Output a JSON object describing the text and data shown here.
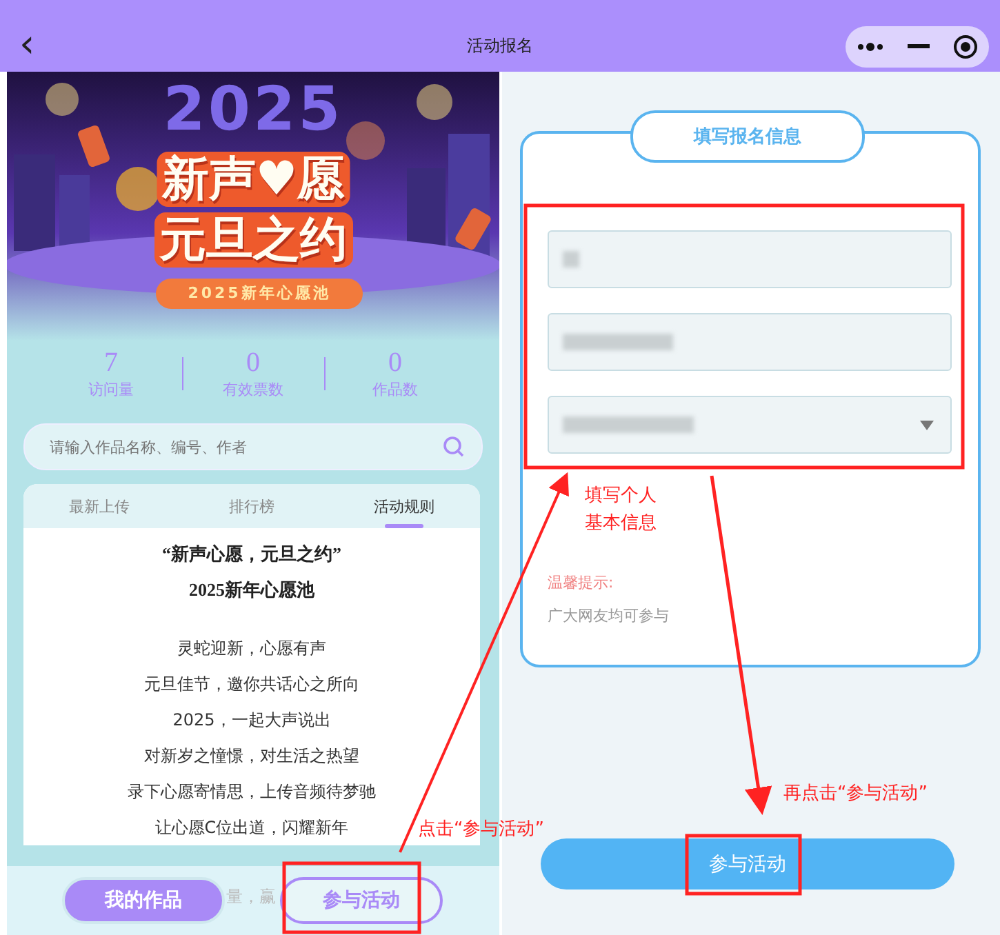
{
  "header": {
    "back": "‹",
    "title": "活动报名"
  },
  "banner": {
    "kind": "picture",
    "year": "2025",
    "title_lines": [
      "新声♥愿",
      "元旦之约"
    ],
    "badge": "2025新年心愿池"
  },
  "stats": [
    {
      "value": "7",
      "label": "访问量"
    },
    {
      "value": "0",
      "label": "有效票数"
    },
    {
      "value": "0",
      "label": "作品数"
    }
  ],
  "search": {
    "placeholder": "请输入作品名称、编号、作者"
  },
  "tabs": [
    {
      "label": "最新上传",
      "selected": false
    },
    {
      "label": "排行榜",
      "selected": false
    },
    {
      "label": "活动规则",
      "selected": true
    }
  ],
  "rules": {
    "headings": [
      "“新声心愿，元旦之约”",
      "2025新年心愿池"
    ],
    "lines": [
      "灵蛇迎新，心愿有声",
      "元旦佳节，邀你共话心之所向",
      "2025，一起大声说出",
      "对新岁之憧憬，对生活之热望",
      "录下心愿寄情思，上传音频待梦驰",
      "让心愿C位出道，闪耀新年"
    ]
  },
  "bottom_bar": {
    "behind_text": "量，赢",
    "buttons": [
      {
        "label": "我的作品",
        "kind": "filled"
      },
      {
        "label": "参与活动",
        "kind": "outline"
      }
    ]
  },
  "form": {
    "title": "填写报名信息",
    "fields": [
      {
        "kind": "text",
        "redacted": true
      },
      {
        "kind": "text",
        "redacted": true
      },
      {
        "kind": "select",
        "redacted": true
      }
    ],
    "tip_title": "温馨提示:",
    "tip_text": "广大网友均可参与",
    "submit": "参与活动"
  },
  "annotations": [
    {
      "text": "填写个人",
      "kind": "fields"
    },
    {
      "text": "基本信息",
      "kind": "fields2"
    },
    {
      "text": "点击“参与活动”",
      "kind": "first"
    },
    {
      "text": "再点击“参与活动”",
      "kind": "second"
    }
  ]
}
